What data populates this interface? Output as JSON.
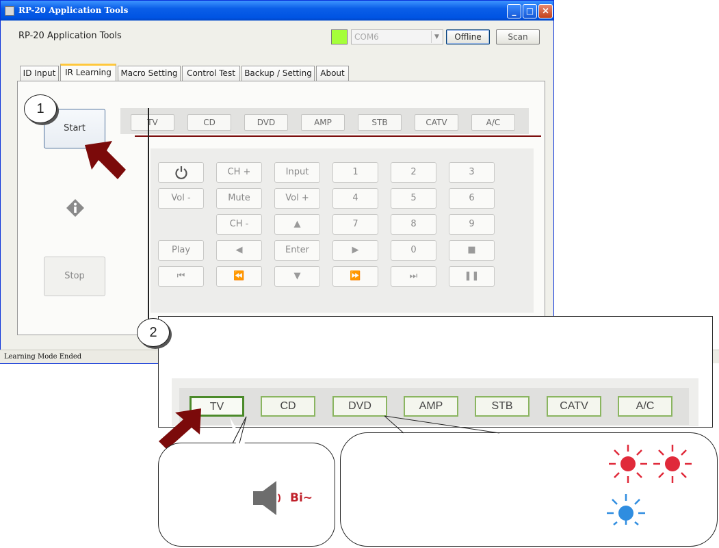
{
  "window": {
    "title": "RP-20 Application Tools",
    "app_label": "RP-20 Application Tools",
    "connection_color": "#a5ff3a",
    "com_port": "COM6",
    "offline_label": "Offline",
    "scan_label": "Scan",
    "status": "Learning Mode Ended"
  },
  "tabs": [
    "ID Input",
    "IR Learning",
    "Macro Setting",
    "Control Test",
    "Backup / Setting",
    "About"
  ],
  "active_tab": "IR Learning",
  "learning": {
    "start_label": "Start",
    "stop_label": "Stop"
  },
  "devices": [
    "TV",
    "CD",
    "DVD",
    "AMP",
    "STB",
    "CATV",
    "A/C"
  ],
  "keypad": {
    "row1": [
      "power-icon",
      "CH +",
      "Input",
      "1",
      "2",
      "3"
    ],
    "row2": [
      "Vol -",
      "Mute",
      "Vol +",
      "4",
      "5",
      "6"
    ],
    "row3": [
      "",
      "CH -",
      "▲",
      "7",
      "8",
      "9"
    ],
    "row4": [
      "Play",
      "◀",
      "Enter",
      "▶",
      "0",
      "■"
    ],
    "row5": [
      "⏮",
      "⏪",
      "▼",
      "⏩",
      "⏭",
      "❚❚"
    ]
  },
  "steps": [
    "1",
    "2"
  ],
  "zoom_devices": [
    "TV",
    "CD",
    "DVD",
    "AMP",
    "STB",
    "CATV",
    "A/C"
  ],
  "sound_text": "Bi~",
  "colors": {
    "arrow": "#7b0a0a",
    "led_red": "#e02a3a",
    "led_blue": "#2f8de0"
  }
}
